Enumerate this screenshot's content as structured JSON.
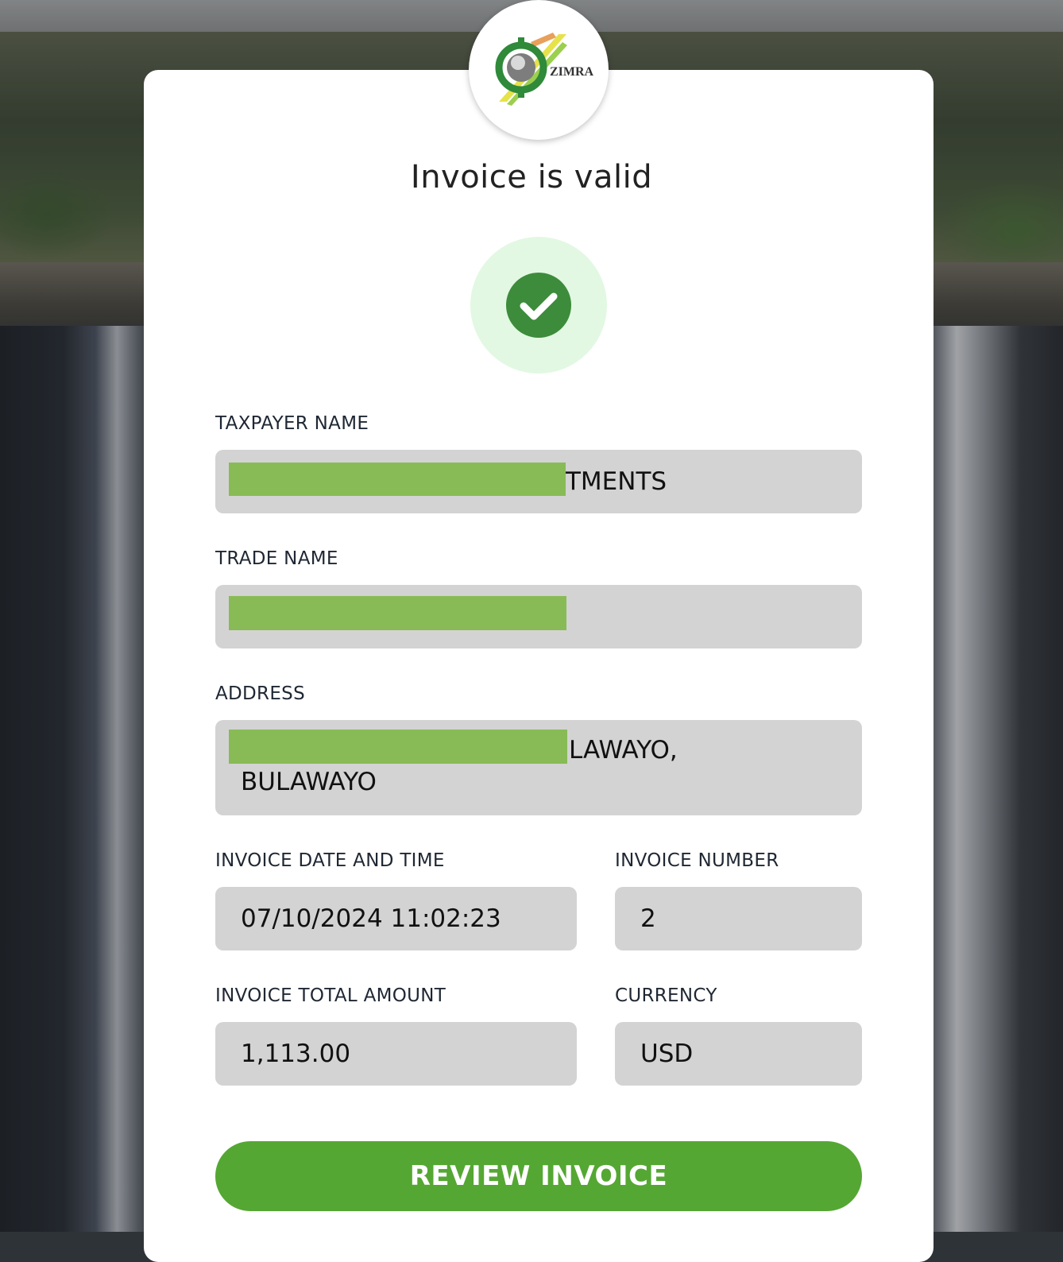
{
  "page": {
    "title": "Invoice is valid",
    "logo_text": "ZIMRA"
  },
  "fields": {
    "taxpayer_name": {
      "label": "TAXPAYER NAME",
      "visible_value": "TMENTS"
    },
    "trade_name": {
      "label": "TRADE NAME",
      "visible_value": ""
    },
    "address": {
      "label": "ADDRESS",
      "visible_value_line1": "LAWAYO,",
      "visible_value_line2": "BULAWAYO"
    },
    "invoice_date_time": {
      "label": "INVOICE DATE AND TIME",
      "value": "07/10/2024 11:02:23"
    },
    "invoice_number": {
      "label": "INVOICE NUMBER",
      "value": "2"
    },
    "invoice_total_amount": {
      "label": "INVOICE TOTAL AMOUNT",
      "value": "1,113.00"
    },
    "currency": {
      "label": "CURRENCY",
      "value": "USD"
    }
  },
  "actions": {
    "review_label": "REVIEW INVOICE"
  },
  "icons": {
    "status": "check-circle-icon",
    "logo": "zimra-logo"
  },
  "colors": {
    "accent": "#55a733",
    "check_dark": "#3c8c3c",
    "check_bg": "#e2f8e2",
    "field_bg": "#d3d3d3",
    "redaction": "#88bb55"
  }
}
